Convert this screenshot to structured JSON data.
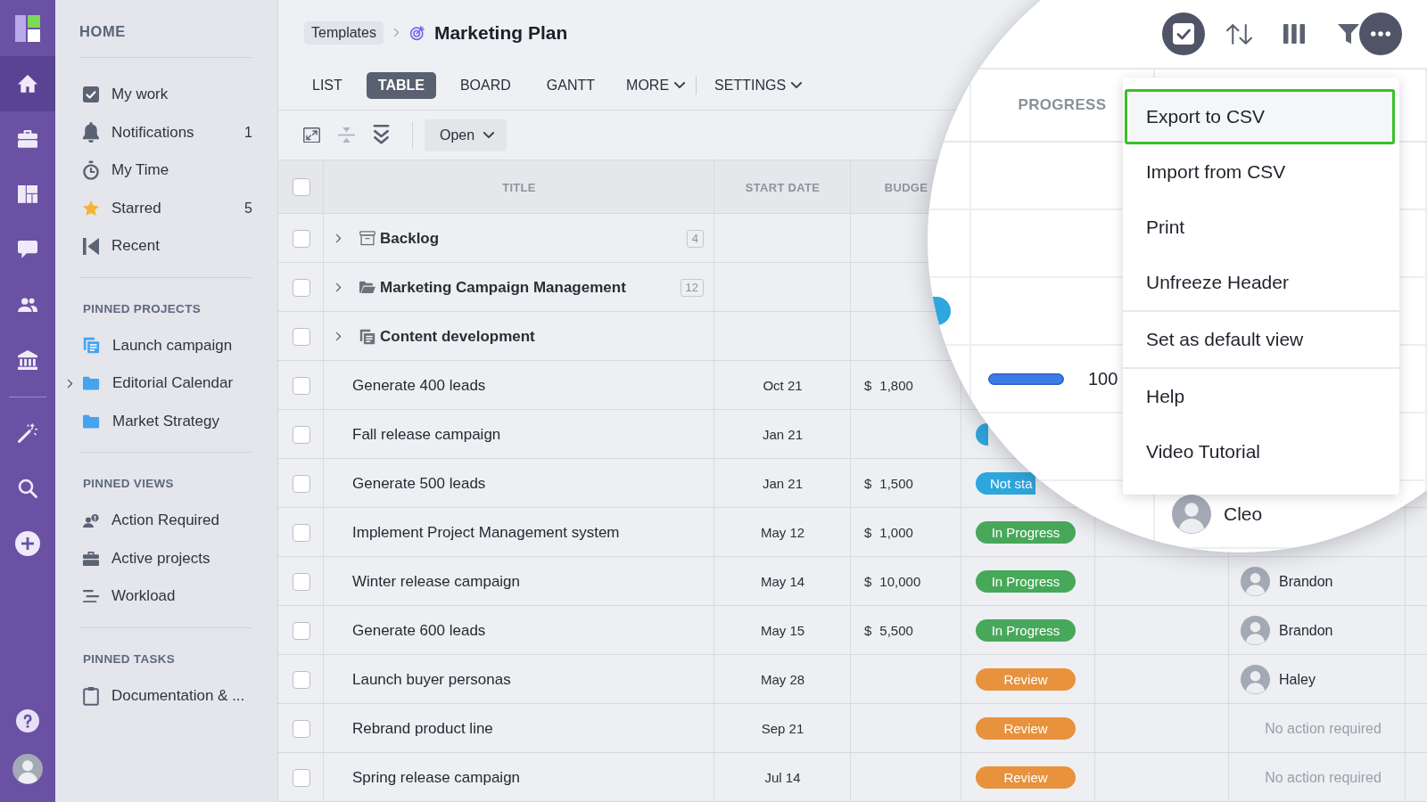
{
  "rail": {
    "top": [
      {
        "selected": true
      },
      {
        "selected": false
      },
      {
        "selected": false
      },
      {
        "selected": false
      },
      {
        "selected": false
      },
      {
        "selected": false
      }
    ],
    "tools": [
      {
        "selected": false
      },
      {
        "selected": false
      },
      {
        "selected": false
      }
    ]
  },
  "sidebar": {
    "home": {
      "heading": "HOME",
      "items": [
        {
          "label": "My work",
          "selected": false
        },
        {
          "label": "Notifications",
          "count": "1",
          "selected": false
        },
        {
          "label": "My Time",
          "selected": false
        },
        {
          "label": "Starred",
          "count": "5",
          "selected": false
        },
        {
          "label": "Recent",
          "selected": false
        }
      ]
    },
    "sections": [
      {
        "heading": "PINNED PROJECTS",
        "items": [
          {
            "label": "Launch campaign",
            "selected": false
          },
          {
            "label": "Editorial Calendar",
            "expanded": false,
            "selected": false
          },
          {
            "label": "Market Strategy",
            "selected": false
          }
        ]
      },
      {
        "heading": "PINNED VIEWS",
        "items": [
          {
            "label": "Action Required",
            "selected": false
          },
          {
            "label": "Active projects",
            "selected": false
          },
          {
            "label": "Workload",
            "selected": false
          }
        ]
      },
      {
        "heading": "PINNED TASKS",
        "items": [
          {
            "label": "Documentation & ...",
            "selected": false
          }
        ]
      }
    ]
  },
  "breadcrumb": {
    "parent": "Templates",
    "title": "Marketing Plan"
  },
  "view_tabs": [
    {
      "label": "LIST",
      "selected": false
    },
    {
      "label": "TABLE",
      "selected": true
    },
    {
      "label": "BOARD",
      "selected": false
    },
    {
      "label": "GANTT",
      "selected": false
    }
  ],
  "view_menus": [
    {
      "label": "MORE"
    },
    {
      "label": "SETTINGS"
    }
  ],
  "toolbar": {
    "buttons": [
      {
        "disabled": false
      },
      {
        "disabled": true
      },
      {
        "disabled": false
      }
    ],
    "filter": {
      "value": "Open"
    }
  },
  "table": {
    "header_checkbox": {
      "checked": false
    },
    "columns": [
      "TITLE",
      "START DATE",
      "BUDGE"
    ],
    "rows": [
      {
        "kind": "group",
        "title": "Backlog",
        "count": "4",
        "expanded": false,
        "checked": false
      },
      {
        "kind": "group",
        "title": "Marketing Campaign Management",
        "count": "12",
        "expanded": false,
        "checked": false
      },
      {
        "kind": "group",
        "title": "Content development",
        "expanded": false,
        "checked": false
      },
      {
        "kind": "task",
        "title": "Generate 400 leads",
        "start_date": "Oct 21",
        "budget": {
          "currency": "$",
          "amount": "1,800"
        },
        "checked": false
      },
      {
        "kind": "task",
        "title": "Fall release campaign",
        "start_date": "Jan 21",
        "status": {
          "color": "#2ea6de",
          "clipped": true
        },
        "checked": false
      },
      {
        "kind": "task",
        "title": "Generate 500 leads",
        "start_date": "Jan 21",
        "budget": {
          "currency": "$",
          "amount": "1,500"
        },
        "status": {
          "label": "Not sta",
          "color": "#2ea6de",
          "clipped": true
        },
        "checked": false
      },
      {
        "kind": "task",
        "title": "Implement Project Management system",
        "start_date": "May 12",
        "budget": {
          "currency": "$",
          "amount": "1,000"
        },
        "status": {
          "label": "In Progress",
          "color": "#47a85a",
          "clipped": false
        },
        "checked": false
      },
      {
        "kind": "task",
        "title": "Winter release campaign",
        "start_date": "May 14",
        "budget": {
          "currency": "$",
          "amount": "10,000"
        },
        "status": {
          "label": "In Progress",
          "color": "#47a85a",
          "clipped": false
        },
        "assignee": "Brandon",
        "checked": false
      },
      {
        "kind": "task",
        "title": "Generate 600 leads",
        "start_date": "May 15",
        "budget": {
          "currency": "$",
          "amount": "5,500"
        },
        "status": {
          "label": "In Progress",
          "color": "#47a85a",
          "clipped": false
        },
        "assignee": "Brandon",
        "checked": false
      },
      {
        "kind": "task",
        "title": "Launch buyer personas",
        "start_date": "May 28",
        "status": {
          "label": "Review",
          "color": "#e8923d",
          "clipped": false
        },
        "assignee": "Haley",
        "checked": false
      },
      {
        "kind": "task",
        "title": "Rebrand product line",
        "start_date": "Sep 21",
        "status": {
          "label": "Review",
          "color": "#e8923d",
          "clipped": false
        },
        "assignee_note": "No action required",
        "checked": false
      },
      {
        "kind": "task",
        "title": "Spring release campaign",
        "start_date": "Jul 14",
        "status": {
          "label": "Review",
          "color": "#e8923d",
          "clipped": false
        },
        "assignee_note": "No action required",
        "checked": false
      }
    ]
  },
  "magnifier": {
    "toolbar": [
      {
        "active": true
      },
      {
        "active": false
      },
      {
        "active": false
      },
      {
        "active": false
      },
      {
        "active": true
      }
    ],
    "progress_header": "PROGRESS",
    "rows": [
      {},
      {},
      {
        "status": {
          "color": "#2ea6de"
        }
      },
      {
        "progress": {
          "level": 1,
          "reading": "100"
        }
      },
      {},
      {
        "assignee": "Cleo"
      }
    ],
    "menu": {
      "sections": [
        [
          {
            "label": "Export to CSV",
            "selected": true
          },
          {
            "label": "Import from CSV",
            "selected": false
          },
          {
            "label": "Print",
            "selected": false
          },
          {
            "label": "Unfreeze Header",
            "selected": false
          }
        ],
        [
          {
            "label": "Set as default view",
            "selected": false
          }
        ],
        [
          {
            "label": "Help",
            "selected": false
          },
          {
            "label": "Video Tutorial",
            "selected": false
          }
        ]
      ]
    }
  }
}
